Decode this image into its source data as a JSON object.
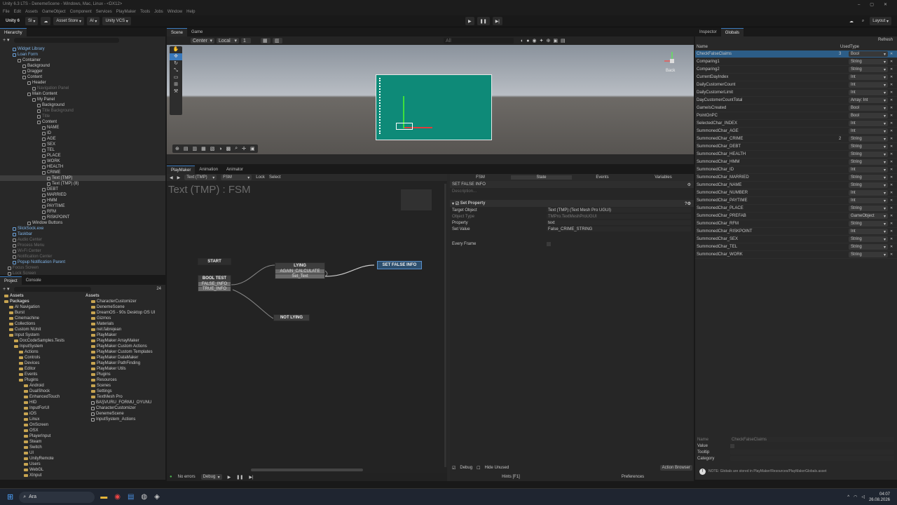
{
  "window": {
    "title": "Unity 6.3 LTS - DenemeScene - Windows, Mac, Linux - <DX12>"
  },
  "menu": [
    "File",
    "Edit",
    "Assets",
    "GameObject",
    "Component",
    "Services",
    "PlayMaker",
    "Tools",
    "Jobs",
    "Window",
    "Help"
  ],
  "toolbar": {
    "unity_label": "Unity 6",
    "account": "SI",
    "asset_store": "Asset Store",
    "ai": "AI",
    "vcs": "Unity VCS",
    "layout": "Layout"
  },
  "hierarchy": {
    "tab": "Hierarchy",
    "items": [
      {
        "label": "Widget Library",
        "indent": 2,
        "style": "blue"
      },
      {
        "label": "Loan Form",
        "indent": 2,
        "style": "blue"
      },
      {
        "label": "Container",
        "indent": 3,
        "style": ""
      },
      {
        "label": "Background",
        "indent": 4,
        "style": ""
      },
      {
        "label": "Dragger",
        "indent": 4,
        "style": ""
      },
      {
        "label": "Content",
        "indent": 4,
        "style": ""
      },
      {
        "label": "Header",
        "indent": 5,
        "style": ""
      },
      {
        "label": "Navigation Panel",
        "indent": 6,
        "style": "dim"
      },
      {
        "label": "Main Content",
        "indent": 5,
        "style": ""
      },
      {
        "label": "My Panel",
        "indent": 6,
        "style": ""
      },
      {
        "label": "Background",
        "indent": 7,
        "style": ""
      },
      {
        "label": "Title Background",
        "indent": 7,
        "style": "dim"
      },
      {
        "label": "Title",
        "indent": 7,
        "style": "dim"
      },
      {
        "label": "Content",
        "indent": 7,
        "style": ""
      },
      {
        "label": "NAME",
        "indent": 8,
        "style": ""
      },
      {
        "label": "ID",
        "indent": 8,
        "style": ""
      },
      {
        "label": "AGE",
        "indent": 8,
        "style": ""
      },
      {
        "label": "SEX",
        "indent": 8,
        "style": ""
      },
      {
        "label": "TEL",
        "indent": 8,
        "style": ""
      },
      {
        "label": "PLACE",
        "indent": 8,
        "style": ""
      },
      {
        "label": "WORK",
        "indent": 8,
        "style": ""
      },
      {
        "label": "HEALTH",
        "indent": 8,
        "style": ""
      },
      {
        "label": "CRIME",
        "indent": 8,
        "style": ""
      },
      {
        "label": "Text (TMP)",
        "indent": 9,
        "style": "sel"
      },
      {
        "label": "Text (TMP) (8)",
        "indent": 9,
        "style": ""
      },
      {
        "label": "DEBT",
        "indent": 8,
        "style": ""
      },
      {
        "label": "MARRIED",
        "indent": 8,
        "style": ""
      },
      {
        "label": "HMM",
        "indent": 8,
        "style": ""
      },
      {
        "label": "PAYTIME",
        "indent": 8,
        "style": ""
      },
      {
        "label": "RFM",
        "indent": 8,
        "style": ""
      },
      {
        "label": "RISKPOINT",
        "indent": 8,
        "style": ""
      },
      {
        "label": "Window Buttons",
        "indent": 5,
        "style": ""
      },
      {
        "label": "SlickSock.exe",
        "indent": 2,
        "style": "blue"
      },
      {
        "label": "Taskbar",
        "indent": 2,
        "style": "blue"
      },
      {
        "label": "Audio Center",
        "indent": 2,
        "style": "dim"
      },
      {
        "label": "Process Menu",
        "indent": 2,
        "style": "dim"
      },
      {
        "label": "Wi-Fi Center",
        "indent": 2,
        "style": "dim"
      },
      {
        "label": "Notification Center",
        "indent": 2,
        "style": "dim"
      },
      {
        "label": "Popup Notification Parent",
        "indent": 2,
        "style": "blue"
      },
      {
        "label": "Focus Screen",
        "indent": 1,
        "style": "dim"
      },
      {
        "label": "Lock Screen",
        "indent": 1,
        "style": "dim"
      }
    ]
  },
  "scene": {
    "tabs": [
      "Scene",
      "Game"
    ],
    "pivot": "Center",
    "space": "Local",
    "snap": "1",
    "search_placeholder": "All",
    "persp": "Back"
  },
  "project": {
    "tabs": [
      "Project",
      "Console"
    ],
    "count": "24",
    "tree": [
      {
        "label": "Assets",
        "indent": 0,
        "style": "bold"
      },
      {
        "label": "Packages",
        "indent": 0,
        "style": "bold"
      },
      {
        "label": "AI Navigation",
        "indent": 1
      },
      {
        "label": "Burst",
        "indent": 1
      },
      {
        "label": "Cinemachine",
        "indent": 1
      },
      {
        "label": "Collections",
        "indent": 1
      },
      {
        "label": "Custom NUnit",
        "indent": 1
      },
      {
        "label": "Input System",
        "indent": 1
      },
      {
        "label": "DocCodeSamples.Tests",
        "indent": 2
      },
      {
        "label": "InputSystem",
        "indent": 2
      },
      {
        "label": "Actions",
        "indent": 3
      },
      {
        "label": "Controls",
        "indent": 3
      },
      {
        "label": "Devices",
        "indent": 3
      },
      {
        "label": "Editor",
        "indent": 3
      },
      {
        "label": "Events",
        "indent": 3
      },
      {
        "label": "Plugins",
        "indent": 3
      },
      {
        "label": "Android",
        "indent": 4
      },
      {
        "label": "DualShock",
        "indent": 4
      },
      {
        "label": "EnhancedTouch",
        "indent": 4
      },
      {
        "label": "HID",
        "indent": 4
      },
      {
        "label": "InputForUI",
        "indent": 4
      },
      {
        "label": "iOS",
        "indent": 4
      },
      {
        "label": "Linux",
        "indent": 4
      },
      {
        "label": "OnScreen",
        "indent": 4
      },
      {
        "label": "OSX",
        "indent": 4
      },
      {
        "label": "PlayerInput",
        "indent": 4
      },
      {
        "label": "Steam",
        "indent": 4
      },
      {
        "label": "Switch",
        "indent": 4
      },
      {
        "label": "UI",
        "indent": 4
      },
      {
        "label": "UnityRemote",
        "indent": 4
      },
      {
        "label": "Users",
        "indent": 4
      },
      {
        "label": "WebGL",
        "indent": 4
      },
      {
        "label": "XInput",
        "indent": 4
      },
      {
        "label": "XR",
        "indent": 4
      }
    ],
    "assets_header": "Assets",
    "assets": [
      "CharacterCustomizer",
      "DenemeScene",
      "DreamOS - 90s Desktop OS UI",
      "Gizmos",
      "Materials",
      "net.fabrejean",
      "PlayMaker",
      "PlayMaker ArrayMaker",
      "PlayMaker Custom Actions",
      "PlayMaker Custom Templates",
      "PlayMaker DataMaker",
      "PlayMaker PathFinding",
      "PlayMaker Utils",
      "Plugins",
      "Resources",
      "Scenes",
      "Settings",
      "TextMesh Pro",
      "BAŞVURU_FORMU_OYUNU",
      "CharacterCustomizer",
      "DenemeScene",
      "InputSystem_Actions"
    ]
  },
  "playmaker": {
    "tabs": [
      "PlayMaker",
      "Animation",
      "Animator"
    ],
    "selected": "Text (TMP)",
    "fsm": "FSM",
    "lock": "Lock",
    "select": "Select",
    "graph_title": "Text (TMP) : FSM",
    "nodes": {
      "start": "START",
      "bool_test": {
        "title": "BOOL TEST",
        "events": [
          "FALSE_INFO",
          "TRUE_INFO"
        ]
      },
      "lying": {
        "title": "LYING",
        "events": [
          "AGAIN_CALCULATE",
          "Set_Text"
        ]
      },
      "set_false": "SET FALSE INFO",
      "not_lying": "NOT LYING"
    },
    "status": {
      "errors": "No errors",
      "debug": "Debug"
    }
  },
  "state_panel": {
    "tabs": [
      "FSM",
      "State",
      "Events",
      "Variables"
    ],
    "state_name": "SET FALSE INFO",
    "description_placeholder": "Description...",
    "action": "Set Property",
    "fields": [
      {
        "label": "Target Object",
        "value": "Text (TMP) (Text Mesh Pro UGUI)"
      },
      {
        "label": "Object Type",
        "value": "TMPro.TextMeshProUGUI"
      },
      {
        "label": "Property",
        "value": "text"
      },
      {
        "label": "Set Value",
        "value": "False_CRIME_STRING"
      }
    ],
    "every_frame": "Every Frame",
    "debug": "Debug",
    "hide_unused": "Hide Unused",
    "action_browser": "Action Browser",
    "hints": "Hints [F1]",
    "preferences": "Preferences"
  },
  "inspector": {
    "tabs": [
      "Inspector",
      "Globals"
    ],
    "refresh": "Refresh",
    "col_name": "Name",
    "col_used": "Used",
    "col_type": "Type",
    "globals": [
      {
        "name": "CheckFalseClaims",
        "used": "3",
        "type": "Bool"
      },
      {
        "name": "Comparing1",
        "used": "",
        "type": "String"
      },
      {
        "name": "Comparing2",
        "used": "",
        "type": "String"
      },
      {
        "name": "CurrentDayIndex",
        "used": "",
        "type": "Int"
      },
      {
        "name": "DailyCustomerCount",
        "used": "",
        "type": "Int"
      },
      {
        "name": "DailyCustomerLimit",
        "used": "",
        "type": "Int"
      },
      {
        "name": "DayCustomerCountTotal",
        "used": "",
        "type": "Array: Int"
      },
      {
        "name": "GameIsCreated",
        "used": "",
        "type": "Bool"
      },
      {
        "name": "PointOnPC",
        "used": "",
        "type": "Bool"
      },
      {
        "name": "SelectedChar_INDEX",
        "used": "",
        "type": "Int"
      },
      {
        "name": "SummonedChar_AGE",
        "used": "",
        "type": "Int"
      },
      {
        "name": "SummonedChar_CRIME",
        "used": "2",
        "type": "String"
      },
      {
        "name": "SummonedChar_DEBT",
        "used": "",
        "type": "String"
      },
      {
        "name": "SummonedChar_HEALTH",
        "used": "",
        "type": "String"
      },
      {
        "name": "SummonedChar_HMM",
        "used": "",
        "type": "String"
      },
      {
        "name": "SummonedChar_ID",
        "used": "",
        "type": "Int"
      },
      {
        "name": "SummonedChar_MARRIED",
        "used": "",
        "type": "String"
      },
      {
        "name": "SummonedChar_NAME",
        "used": "",
        "type": "String"
      },
      {
        "name": "SummonedChar_NUMBER",
        "used": "",
        "type": "Int"
      },
      {
        "name": "SummonedChar_PAYTIME",
        "used": "",
        "type": "Int"
      },
      {
        "name": "SummonedChar_PLACE",
        "used": "",
        "type": "String"
      },
      {
        "name": "SummonedChar_PREFAB",
        "used": "",
        "type": "GameObject"
      },
      {
        "name": "SummonedChar_RFM",
        "used": "",
        "type": "String"
      },
      {
        "name": "SummonedChar_RISKPOINT",
        "used": "",
        "type": "Int"
      },
      {
        "name": "SummonedChar_SEX",
        "used": "",
        "type": "String"
      },
      {
        "name": "SummonedChar_TEL",
        "used": "",
        "type": "String"
      },
      {
        "name": "SummonedChar_WORK",
        "used": "",
        "type": "String"
      }
    ],
    "detail": {
      "name_label": "Name",
      "name_value": "CheckFalseClaims",
      "value_label": "Value",
      "tooltip_label": "Tooltip",
      "category_label": "Category"
    },
    "note": "NOTE: Globals are stored in PlayMaker/Resources/PlayMakerGlobals.asset"
  },
  "taskbar": {
    "search_placeholder": "Ara",
    "time": "04:07",
    "date": "26.08.2026"
  },
  "colors": {
    "accent": "#3a79bb",
    "selection": "#2c5d87",
    "node_active": "#2d4f6e"
  }
}
